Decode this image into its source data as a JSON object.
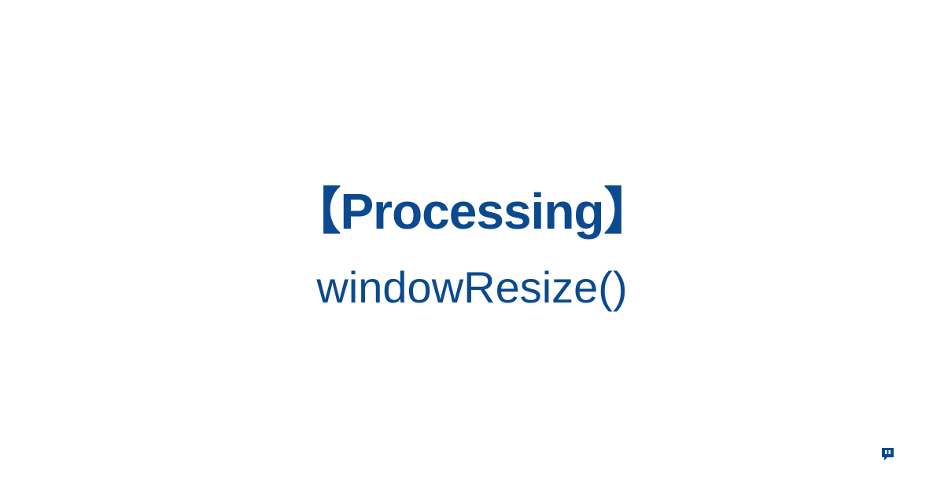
{
  "title_bracket_open": "【",
  "title_text": "Processing",
  "title_bracket_close": "】",
  "subtitle": "windowResize()",
  "colors": {
    "text": "#0b4a8f",
    "background": "#ffffff"
  }
}
